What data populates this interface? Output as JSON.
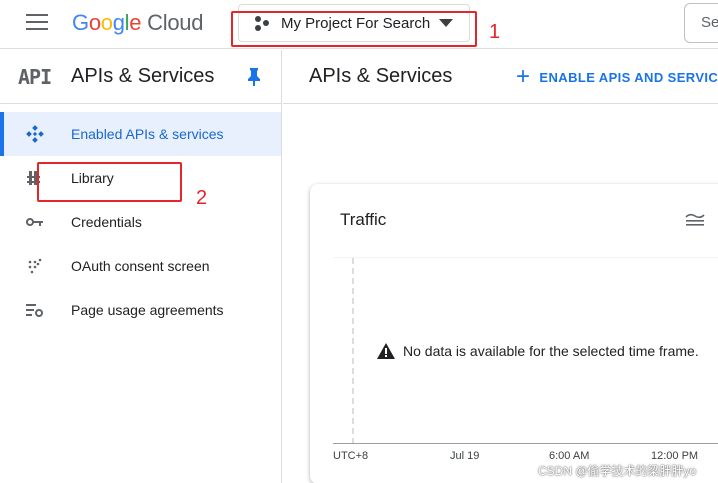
{
  "header": {
    "logo_letters": [
      "G",
      "o",
      "o",
      "g",
      "l",
      "e"
    ],
    "logo_product": "Cloud",
    "project_name": "My Project For Search",
    "search_placeholder": "Se"
  },
  "annotations": {
    "first": "1",
    "second": "2"
  },
  "sidebar": {
    "badge": "API",
    "title": "APIs & Services",
    "items": [
      {
        "label": "Enabled APIs & services",
        "icon": "apis-diamond-icon"
      },
      {
        "label": "Library",
        "icon": "library-icon"
      },
      {
        "label": "Credentials",
        "icon": "key-icon"
      },
      {
        "label": "OAuth consent screen",
        "icon": "oauth-dots-icon"
      },
      {
        "label": "Page usage agreements",
        "icon": "settings-list-icon"
      }
    ]
  },
  "main": {
    "title": "APIs & Services",
    "enable_button": "ENABLE APIS AND SERVICES"
  },
  "traffic_card": {
    "title": "Traffic",
    "no_data": "No data is available for the selected time frame.",
    "x_labels": [
      "UTC+8",
      "Jul 19",
      "6:00 AM",
      "12:00 PM"
    ]
  },
  "watermark": "CSDN @偷学技术的梁胖胖yo",
  "colors": {
    "accent": "#1a73e8",
    "active_bg": "#e8f0fe",
    "annotation_red": "#e4262b"
  }
}
